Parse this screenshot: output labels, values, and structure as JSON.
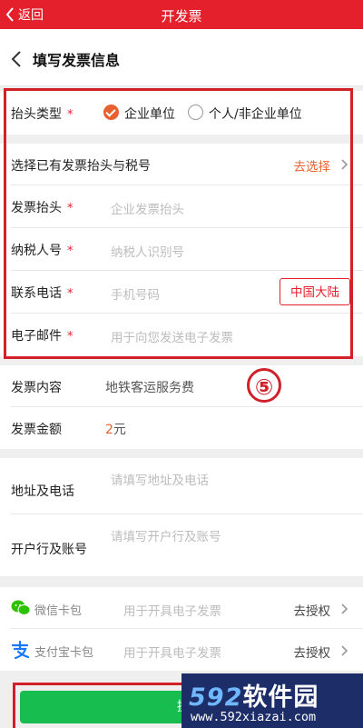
{
  "topbar": {
    "back_label": "返回",
    "title": "开发票"
  },
  "subheader": {
    "title": "填写发票信息"
  },
  "form": {
    "title_type": {
      "label": "抬头类型",
      "required_mark": "*",
      "option_selected": "企业单位",
      "option_other": "个人/非企业单位"
    },
    "select_existing": {
      "label": "选择已有发票抬头与税号",
      "action": "去选择"
    },
    "invoice_title": {
      "label": "发票抬头",
      "required_mark": "*",
      "placeholder": "企业发票抬头"
    },
    "tax_id": {
      "label": "纳税人号",
      "required_mark": "*",
      "placeholder": "纳税人识别号"
    },
    "phone": {
      "label": "联系电话",
      "required_mark": "*",
      "placeholder": "手机号码",
      "region_button": "中国大陆"
    },
    "email": {
      "label": "电子邮件",
      "required_mark": "*",
      "placeholder": "用于向您发送电子发票"
    },
    "content": {
      "label": "发票内容",
      "value": "地铁客运服务费"
    },
    "amount": {
      "label": "发票金额",
      "value_number": "2",
      "value_unit": "元"
    },
    "address": {
      "label": "地址及电话",
      "placeholder": "请填写地址及电话"
    },
    "bank": {
      "label": "开户行及账号",
      "placeholder": "请填写开户行及账号"
    }
  },
  "wallets": {
    "wechat": {
      "label": "微信卡包",
      "hint": "用于开具电子发票",
      "action": "去授权"
    },
    "alipay": {
      "label": "支付宝卡包",
      "hint": "用于开具电子发票",
      "action": "去授权"
    }
  },
  "annotation": {
    "step_number": "⑤"
  },
  "submit_button": {
    "label": "提"
  },
  "watermark": {
    "num": "592",
    "name": "软件园",
    "url": "www.592xiazai.com"
  },
  "colors": {
    "topbar": "#e3202b",
    "accent": "#e8612e",
    "submit": "#18bd4f",
    "annotation": "#d0202a"
  }
}
